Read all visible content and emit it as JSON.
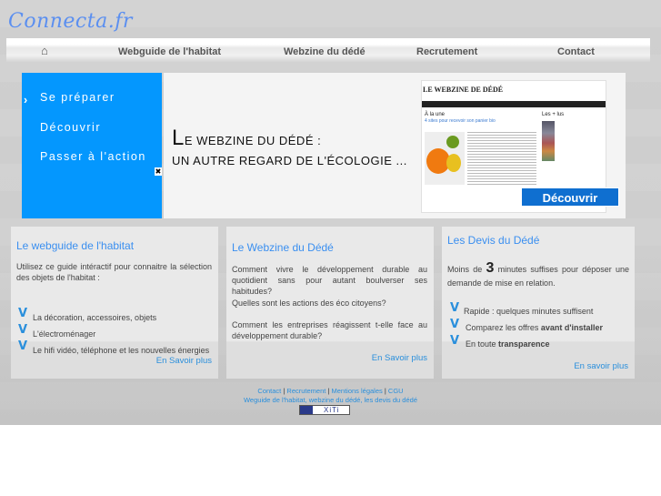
{
  "logo": "Connecta.fr",
  "nav": {
    "home_icon": "home-icon",
    "items": [
      "Webguide de l'habitat",
      "Webzine du dédé",
      "Recrutement",
      "Contact"
    ]
  },
  "banner": {
    "menu": [
      "Se préparer",
      "Découvrir",
      "Passer à l'action"
    ],
    "title_initial": "L",
    "title_rest": "E WEBZINE DU DÉDÉ :",
    "subtitle": "UN AUTRE REGARD DE L'ÉCOLOGIE ...",
    "shot_title": "LE WEBZINE DE DÉDÉ",
    "shot_headline": "À la une",
    "shot_article": "4 sites pour recevoir son panier bio",
    "shot_side": "Les + lus",
    "discover": "Découvrir"
  },
  "boxes": [
    {
      "title": "Le webguide de l'habitat",
      "text": "Utilisez ce guide intéractif pour connaitre la sélection des objets de l'habitat :",
      "items": [
        "La décoration, accessoires, objets",
        "L'électroménager",
        "Le hifi vidéo, téléphone et les nouvelles énergies"
      ],
      "more": "En Savoir plus"
    },
    {
      "title": "Le Webzine du Dédé",
      "p1": "Comment vivre le développement durable au quotidient sans pour autant boulverser ses habitudes?",
      "p2": "Quelles sont les actions des éco citoyens?",
      "p3": "Comment les entreprises réagissent t-elle face au développement durable?",
      "more": "En Savoir plus"
    },
    {
      "title": "Les Devis du Dédé",
      "t1": "Moins de",
      "num": "3",
      "t2": "minutes suffises pour déposer une demande de mise en relation.",
      "items": [
        {
          "a": "Rapide : quelques minutes suffisent",
          "b": ""
        },
        {
          "a": "Comparez les offres ",
          "b": "avant d'installer"
        },
        {
          "a": "En toute ",
          "b": "transparence"
        }
      ],
      "more": "En savoir plus"
    }
  ],
  "footer": {
    "links": [
      "Contact",
      "Recrutement",
      "Mentions légales",
      "CGU"
    ],
    "sep": "|",
    "line2": "Weguide de l'habitat, webzine du dédé, les devis du dédé",
    "xiti": "XiTi"
  }
}
